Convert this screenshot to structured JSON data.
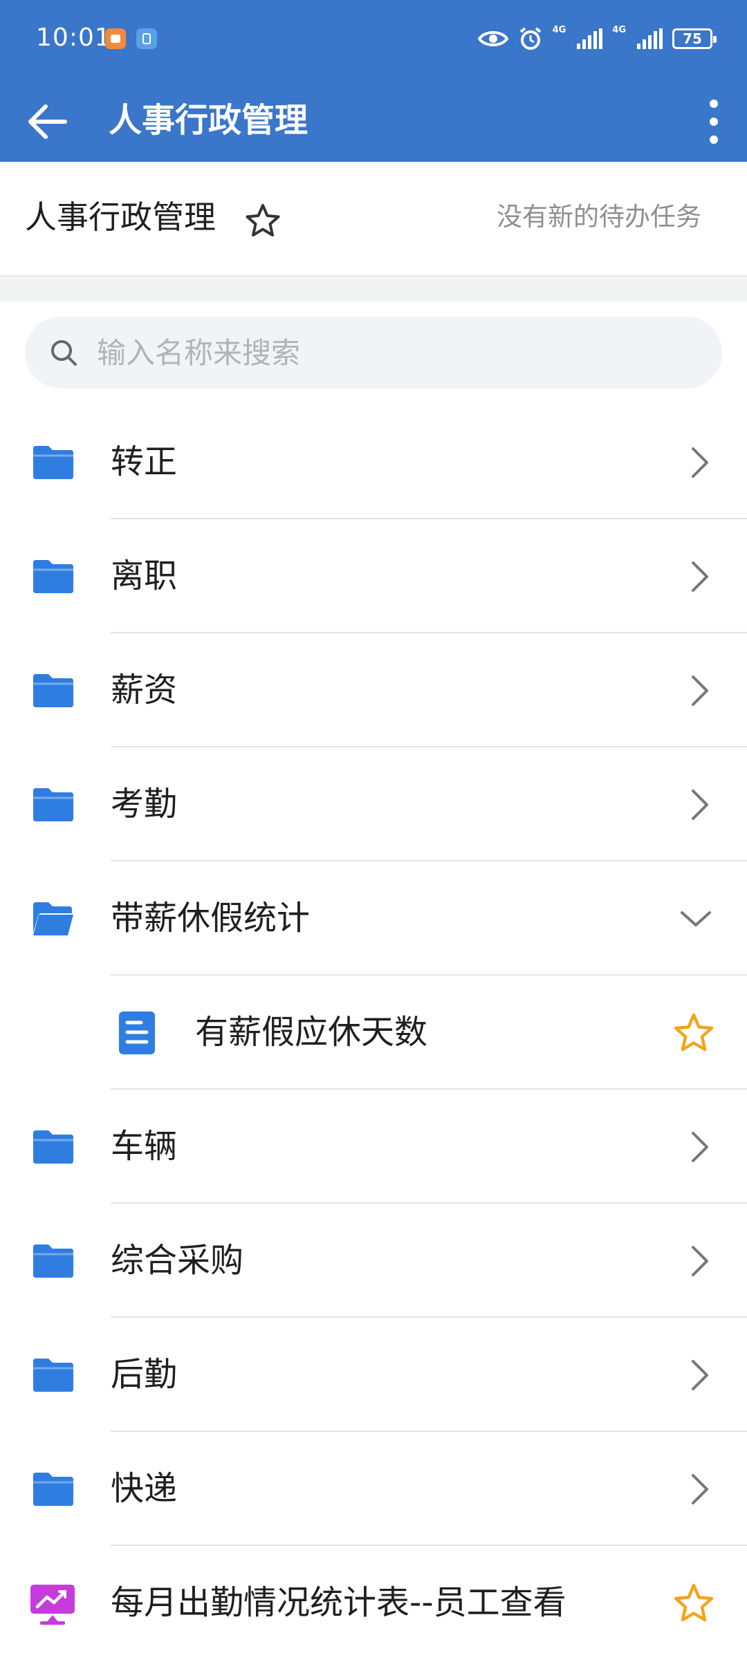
{
  "status_bar": {
    "time": "10:01",
    "net1": "4G",
    "net2": "4G",
    "battery": "75",
    "icons": [
      "app-notification-icon",
      "app-badge-icon",
      "eye-icon",
      "alarm-icon",
      "signal-icon",
      "signal-icon",
      "battery-icon"
    ]
  },
  "app_bar": {
    "title": "人事行政管理",
    "back_icon": "arrow-left-icon",
    "more_icon": "more-vertical-icon"
  },
  "subheader": {
    "title": "人事行政管理",
    "star_icon": "star-outline-icon",
    "tasks": "没有新的待办任务"
  },
  "search": {
    "placeholder": "输入名称来搜索",
    "value": ""
  },
  "list": [
    {
      "label": "转正",
      "icon": "folder-icon",
      "state": "collapsed"
    },
    {
      "label": "离职",
      "icon": "folder-icon",
      "state": "collapsed"
    },
    {
      "label": "薪资",
      "icon": "folder-icon",
      "state": "collapsed"
    },
    {
      "label": "考勤",
      "icon": "folder-icon",
      "state": "collapsed"
    },
    {
      "label": "带薪休假统计",
      "icon": "folder-open-icon",
      "state": "expanded"
    },
    {
      "label": "有薪假应休天数",
      "icon": "document-icon",
      "starred": true
    },
    {
      "label": "车辆",
      "icon": "folder-icon",
      "state": "collapsed"
    },
    {
      "label": "综合采购",
      "icon": "folder-icon",
      "state": "collapsed"
    },
    {
      "label": "后勤",
      "icon": "folder-icon",
      "state": "collapsed"
    },
    {
      "label": "快递",
      "icon": "folder-icon",
      "state": "collapsed"
    },
    {
      "label": "每月出勤情况统计表--员工查看",
      "icon": "report-chart-icon",
      "starred": true
    }
  ],
  "colors": {
    "primary": "#3a76c9",
    "folder": "#2f7de1",
    "star": "#f2a51a",
    "report": "#c63bdc",
    "muted_text": "#8f8f8f"
  }
}
